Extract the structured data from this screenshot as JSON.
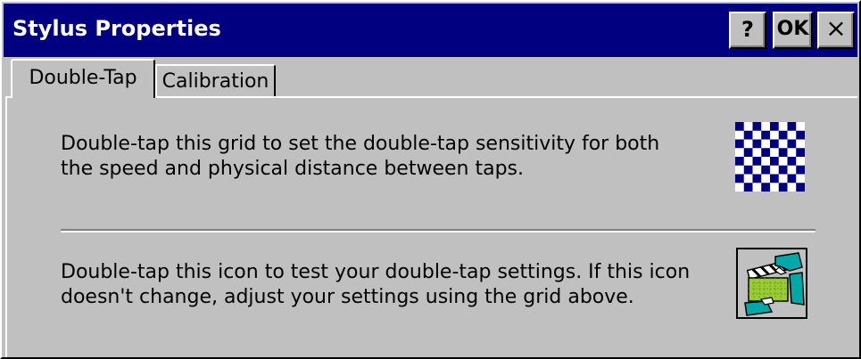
{
  "window": {
    "title": "Stylus Properties",
    "help_label": "?",
    "ok_label": "OK",
    "close_label": "×"
  },
  "tabs": [
    {
      "label": "Double-Tap",
      "active": true
    },
    {
      "label": "Calibration",
      "active": false
    }
  ],
  "double_tap": {
    "grid_text_line1": "Double-tap this grid to set the double-tap sensitivity for both",
    "grid_text_line2": "the speed and physical distance between taps.",
    "test_text_line1": "Double-tap this icon to test your double-tap settings. If this icon",
    "test_text_line2": "doesn't change, adjust your settings using the grid above."
  },
  "colors": {
    "title_bar": "#000080",
    "face": "#c0c0c0",
    "grid_dark": "#000080",
    "grid_light": "#ffffff",
    "clapper_green": "#99cc33",
    "hand_teal": "#00a8a8"
  },
  "icons": {
    "grid": "checkerboard-grid-icon",
    "test": "clapperboard-hands-icon"
  }
}
